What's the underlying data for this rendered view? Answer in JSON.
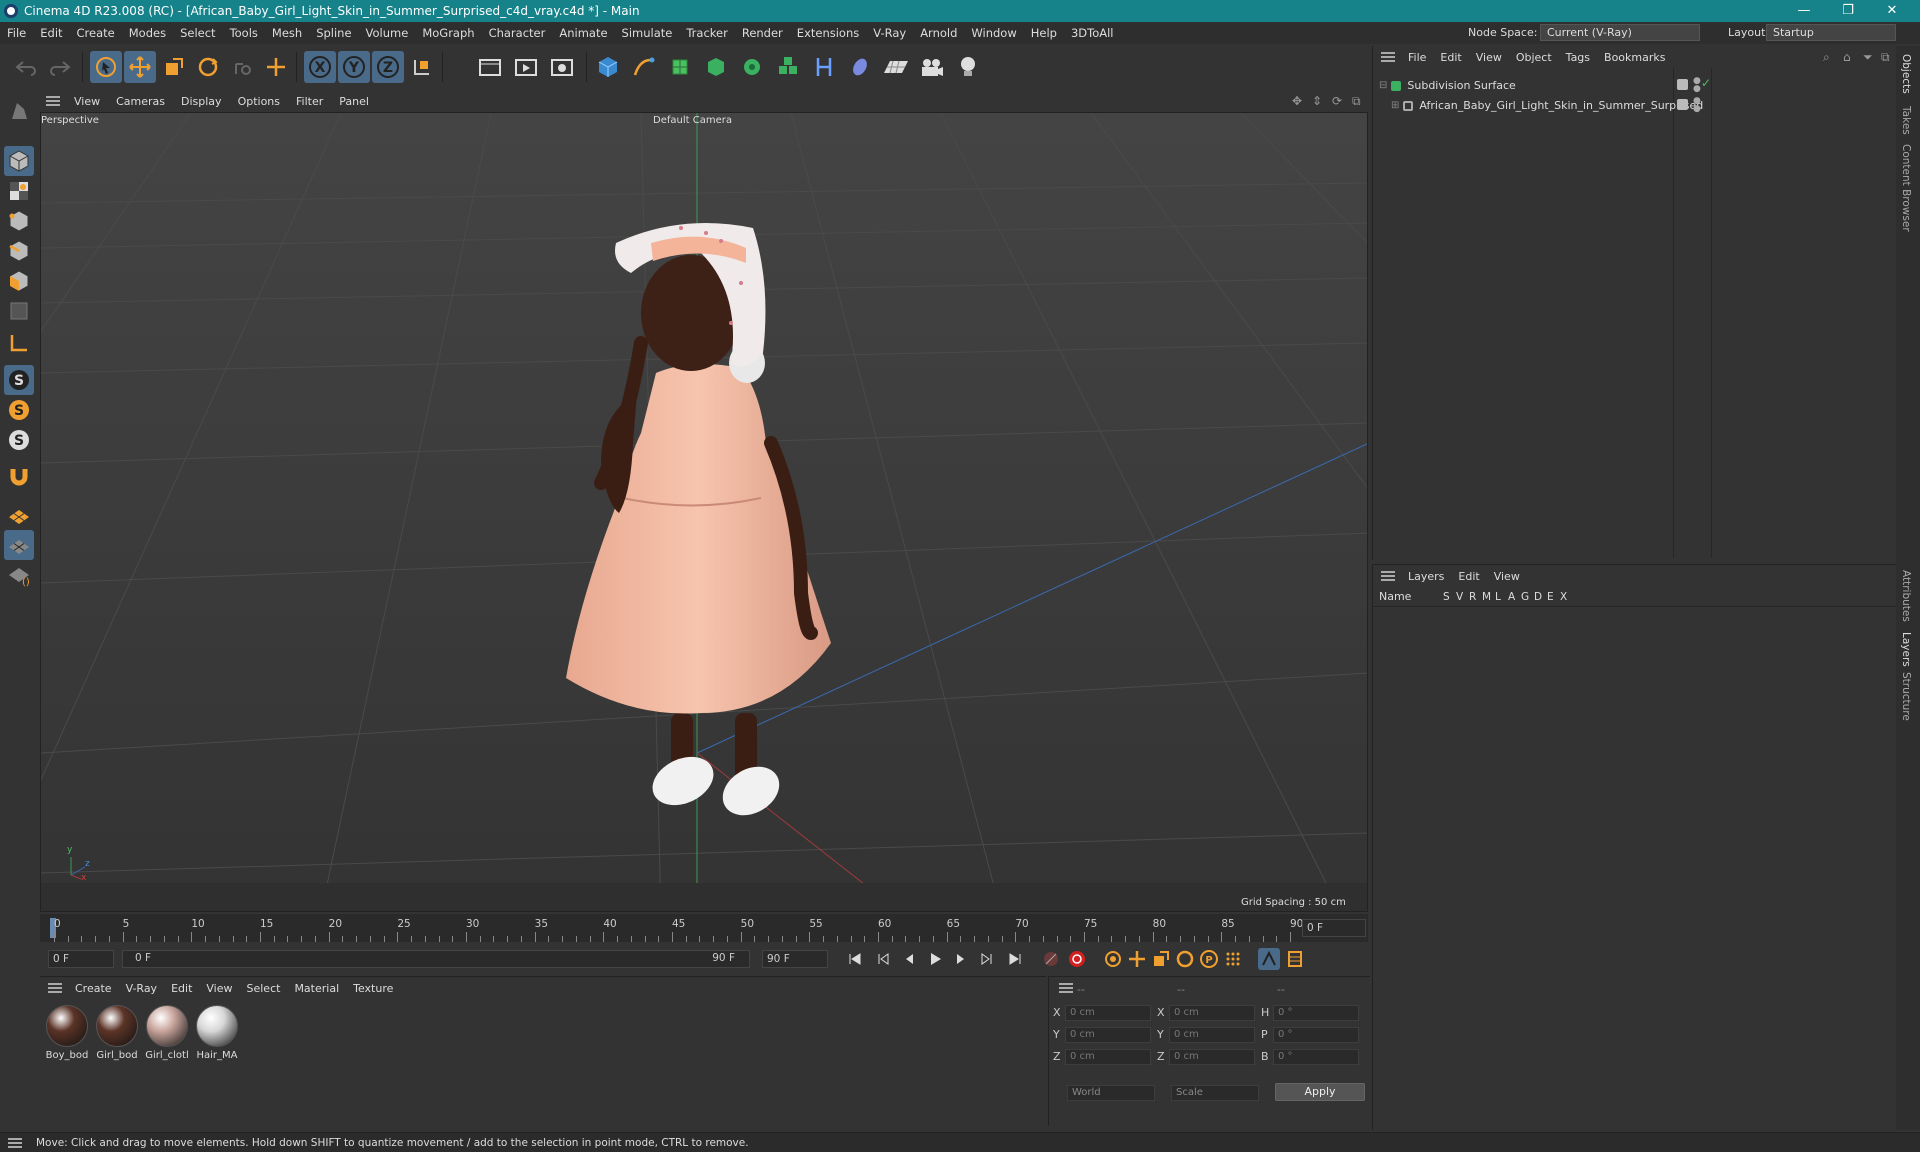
{
  "titlebar": {
    "title": "Cinema 4D R23.008 (RC) - [African_Baby_Girl_Light_Skin_in_Summer_Surprised_c4d_vray.c4d *] - Main",
    "minimize": "—",
    "restore": "❐",
    "close": "✕"
  },
  "menubar": {
    "items": [
      "File",
      "Edit",
      "Create",
      "Modes",
      "Select",
      "Tools",
      "Mesh",
      "Spline",
      "Volume",
      "MoGraph",
      "Character",
      "Animate",
      "Simulate",
      "Tracker",
      "Render",
      "Extensions",
      "V-Ray",
      "Arnold",
      "Window",
      "Help",
      "3DToAll"
    ],
    "node_space_label": "Node Space:",
    "node_space_value": "Current (V-Ray)",
    "layout_label": "Layout:",
    "layout_value": "Startup"
  },
  "viewport": {
    "menu": [
      "View",
      "Cameras",
      "Display",
      "Options",
      "Filter",
      "Panel"
    ],
    "view_name": "Perspective",
    "camera_name": "Default Camera",
    "grid_spacing": "Grid Spacing : 50 cm",
    "axis_y": "y",
    "axis_z": "z",
    "axis_x": "x"
  },
  "timeline": {
    "ticks": [
      "0",
      "5",
      "10",
      "15",
      "20",
      "25",
      "30",
      "35",
      "40",
      "45",
      "50",
      "55",
      "60",
      "65",
      "70",
      "75",
      "80",
      "85",
      "90"
    ],
    "current_frame": "0 F"
  },
  "transport": {
    "start_frame": "0 F",
    "range_start": "0 F",
    "range_end": "90 F",
    "end_frame": "90 F"
  },
  "materials": {
    "menu": [
      "Create",
      "V-Ray",
      "Edit",
      "View",
      "Select",
      "Material",
      "Texture"
    ],
    "items": [
      {
        "label": "Boy_bod",
        "color": "#5a3326"
      },
      {
        "label": "Girl_bod",
        "color": "#5c3427"
      },
      {
        "label": "Girl_clotl",
        "color": "#c9a59c"
      },
      {
        "label": "Hair_MA",
        "color": "#d8d8d8"
      }
    ]
  },
  "coords": {
    "headers": [
      "--",
      "--",
      "--"
    ],
    "rows": [
      {
        "l1": "X",
        "v1": "0 cm",
        "l2": "X",
        "v2": "0 cm",
        "l3": "H",
        "v3": "0 °"
      },
      {
        "l1": "Y",
        "v1": "0 cm",
        "l2": "Y",
        "v2": "0 cm",
        "l3": "P",
        "v3": "0 °"
      },
      {
        "l1": "Z",
        "v1": "0 cm",
        "l2": "Z",
        "v2": "0 cm",
        "l3": "B",
        "v3": "0 °"
      }
    ],
    "world": "World",
    "scale": "Scale",
    "apply": "Apply"
  },
  "objects": {
    "menu": [
      "File",
      "Edit",
      "View",
      "Object",
      "Tags",
      "Bookmarks"
    ],
    "items": [
      {
        "name": "Subdivision Surface"
      },
      {
        "name": "African_Baby_Girl_Light_Skin_in_Summer_Surprised"
      }
    ]
  },
  "layers": {
    "menu": [
      "Layers",
      "Edit",
      "View"
    ],
    "name_col": "Name",
    "cols": [
      "S",
      "V",
      "R",
      "M",
      "L",
      "A",
      "G",
      "D",
      "E",
      "X"
    ]
  },
  "sidetabs": [
    "Objects",
    "Takes",
    "Content Browser",
    "Attributes",
    "Layers",
    "Structure"
  ],
  "status": "Move: Click and drag to move elements. Hold down SHIFT to quantize movement / add to the selection in point mode, CTRL to remove.",
  "colors": {
    "titlebar": "#16828a",
    "accent_orange": "#f0a030",
    "accent_blue": "#4aa0e0"
  }
}
